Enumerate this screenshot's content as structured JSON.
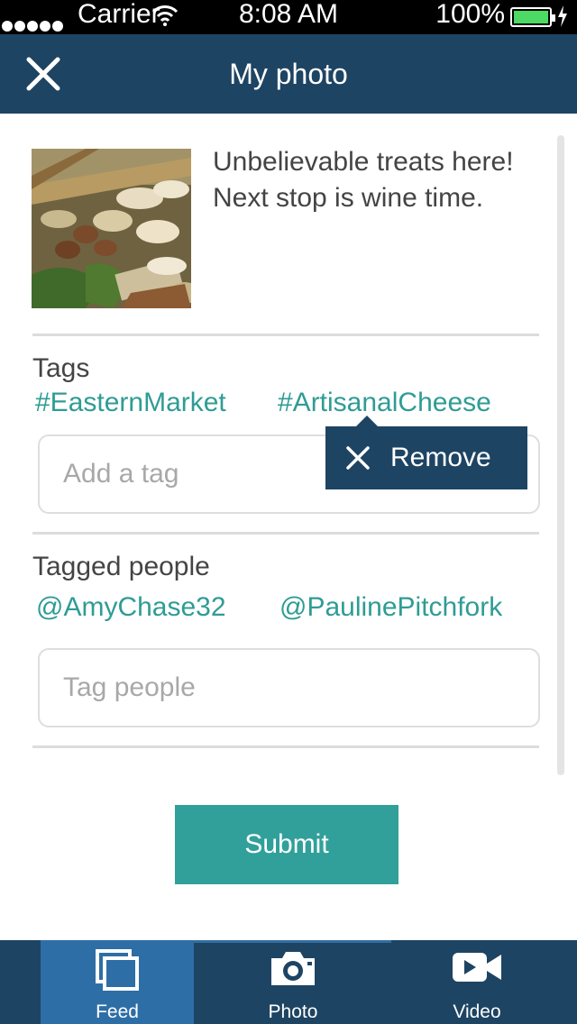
{
  "status_bar": {
    "carrier": "Carrier",
    "time": "8:08 AM",
    "battery": "100%",
    "battery_color": "#4cd964"
  },
  "nav": {
    "title": "My photo",
    "close_icon": "close-icon"
  },
  "post": {
    "caption": "Unbelievable treats here! Next stop is wine time."
  },
  "tags": {
    "label": "Tags",
    "items": [
      "#EasternMarket",
      "#ArtisanalCheese"
    ],
    "input_placeholder": "Add a tag",
    "input_value": ""
  },
  "tooltip": {
    "label": "Remove",
    "icon": "close-icon"
  },
  "people": {
    "label": "Tagged people",
    "items": [
      "@AmyChase32",
      "@PaulinePitchfork"
    ],
    "input_placeholder": "Tag people",
    "input_value": ""
  },
  "submit_label": "Submit",
  "tab_bar": {
    "items": [
      {
        "label": "Feed",
        "icon": "feed-icon",
        "active": true
      },
      {
        "label": "Photo",
        "icon": "camera-icon",
        "active": false
      },
      {
        "label": "Video",
        "icon": "video-icon",
        "active": false
      }
    ]
  },
  "colors": {
    "primary": "#1e4463",
    "accent_teal": "#31a09a",
    "link": "#2f9c95",
    "active_tab": "#2e6ea6"
  }
}
